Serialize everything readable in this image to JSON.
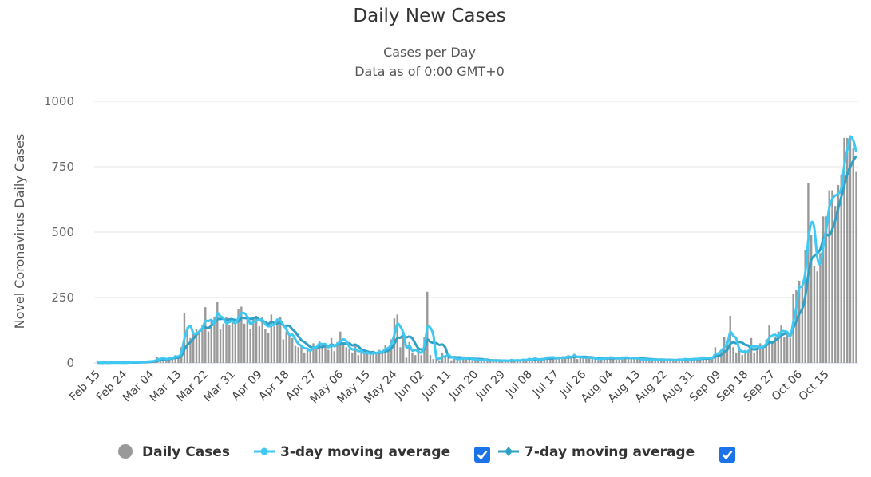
{
  "chart_data": {
    "type": "bar",
    "title": "Daily New Cases",
    "subtitle": [
      "Cases per Day",
      "Data as of 0:00 GMT+0"
    ],
    "xlabel": "",
    "ylabel": "Novel Coronavirus Daily Cases",
    "ylim": [
      0,
      1000
    ],
    "yticks": [
      "0",
      "250",
      "500",
      "750",
      "1000"
    ],
    "ytick_values": [
      0,
      250,
      500,
      750,
      1000
    ],
    "grid": true,
    "legend_placement": "bottom",
    "xticks": [
      "Feb 15",
      "Feb 24",
      "Mar 04",
      "Mar 13",
      "Mar 22",
      "Mar 31",
      "Apr 09",
      "Apr 18",
      "Apr 27",
      "May 06",
      "May 15",
      "May 24",
      "Jun 02",
      "Jun 11",
      "Jun 20",
      "Jun 29",
      "Jul 08",
      "Jul 17",
      "Jul 26",
      "Aug 04",
      "Aug 13",
      "Aug 22",
      "Aug 31",
      "Sep 09",
      "Sep 18",
      "Sep 27",
      "Oct 06",
      "Oct 15"
    ],
    "xtick_interval_days": 9,
    "colors": {
      "bars": "#999999",
      "ma3": "#3ec8f2",
      "ma7": "#2fa0c6",
      "checkbox": "#1a73e8",
      "grid": "#e6e6e6"
    },
    "series": [
      {
        "name": "Daily Cases",
        "kind": "bar",
        "values": [
          1,
          0,
          2,
          1,
          0,
          3,
          1,
          2,
          0,
          1,
          2,
          3,
          1,
          2,
          3,
          5,
          4,
          8,
          6,
          10,
          22,
          15,
          18,
          12,
          22,
          20,
          30,
          25,
          60,
          190,
          137,
          95,
          110,
          130,
          120,
          145,
          213,
          120,
          160,
          175,
          232,
          130,
          150,
          175,
          145,
          160,
          150,
          205,
          215,
          150,
          165,
          130,
          175,
          180,
          140,
          175,
          130,
          115,
          185,
          140,
          170,
          175,
          90,
          120,
          110,
          95,
          65,
          60,
          70,
          40,
          55,
          45,
          75,
          60,
          85,
          70,
          60,
          50,
          95,
          45,
          80,
          120,
          70,
          60,
          55,
          40,
          65,
          30,
          45,
          35,
          40,
          30,
          45,
          35,
          50,
          40,
          70,
          60,
          90,
          170,
          185,
          60,
          100,
          20,
          80,
          40,
          30,
          60,
          30,
          100,
          272,
          30,
          15,
          25,
          10,
          40,
          20,
          35,
          10,
          15,
          20,
          10,
          25,
          15,
          20,
          10,
          12,
          15,
          8,
          10,
          12,
          6,
          10,
          8,
          12,
          5,
          10,
          8,
          15,
          6,
          10,
          12,
          15,
          8,
          20,
          12,
          18,
          10,
          15,
          20,
          25,
          18,
          22,
          15,
          20,
          25,
          18,
          30,
          20,
          35,
          15,
          20,
          25,
          18,
          22,
          15,
          20,
          10,
          18,
          22,
          15,
          25,
          20,
          12,
          18,
          25,
          20,
          15,
          22,
          18,
          15,
          12,
          15,
          12,
          10,
          18,
          12,
          8,
          15,
          10,
          12,
          8,
          14,
          10,
          15,
          12,
          18,
          10,
          15,
          20,
          12,
          18,
          25,
          15,
          20,
          20,
          60,
          30,
          50,
          100,
          70,
          180,
          60,
          40,
          60,
          30,
          45,
          50,
          95,
          40,
          60,
          75,
          55,
          90,
          143,
          80,
          100,
          120,
          143,
          100,
          110,
          95,
          262,
          280,
          314,
          290,
          432,
          686,
          490,
          370,
          350,
          420,
          560,
          560,
          660,
          660,
          600,
          680,
          720,
          860,
          860,
          870,
          820,
          730
        ]
      },
      {
        "name": "3-day moving average",
        "kind": "line",
        "window": 3,
        "checked": true
      },
      {
        "name": "7-day moving average",
        "kind": "line",
        "window": 7,
        "checked": true
      }
    ]
  }
}
